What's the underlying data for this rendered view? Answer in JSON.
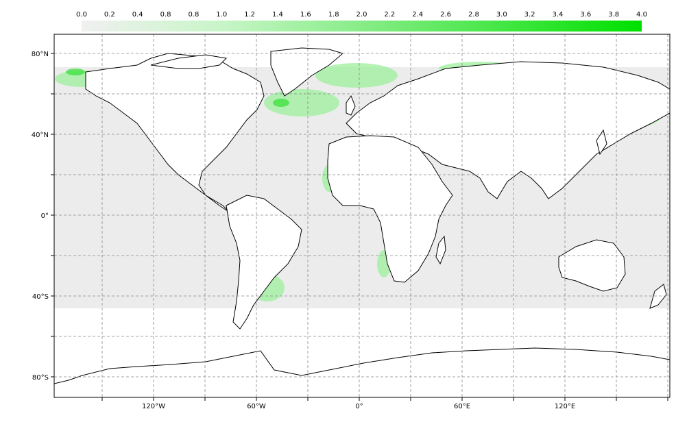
{
  "colorbar": {
    "ticks": [
      "0.0",
      "0.2",
      "0.4",
      "0.8",
      "0.8",
      "1.0",
      "1.2",
      "1.4",
      "1.6",
      "1.8",
      "2.0",
      "2.2",
      "2.4",
      "2.6",
      "2.8",
      "3.0",
      "3.2",
      "3.4",
      "3.6",
      "3.8",
      "4.0"
    ],
    "color_low": "#f0f0f0",
    "color_high": "#00e000"
  },
  "map": {
    "lat_labels": [
      "80°N",
      "40°N",
      "0°",
      "40°S",
      "80°S"
    ],
    "lon_labels": [
      "120°W",
      "60°W",
      "0°",
      "60°E",
      "120°E"
    ],
    "grid": true,
    "ocean_background": "#ececec",
    "land_color": "#ffffff",
    "coastline_color": "#000000"
  }
}
